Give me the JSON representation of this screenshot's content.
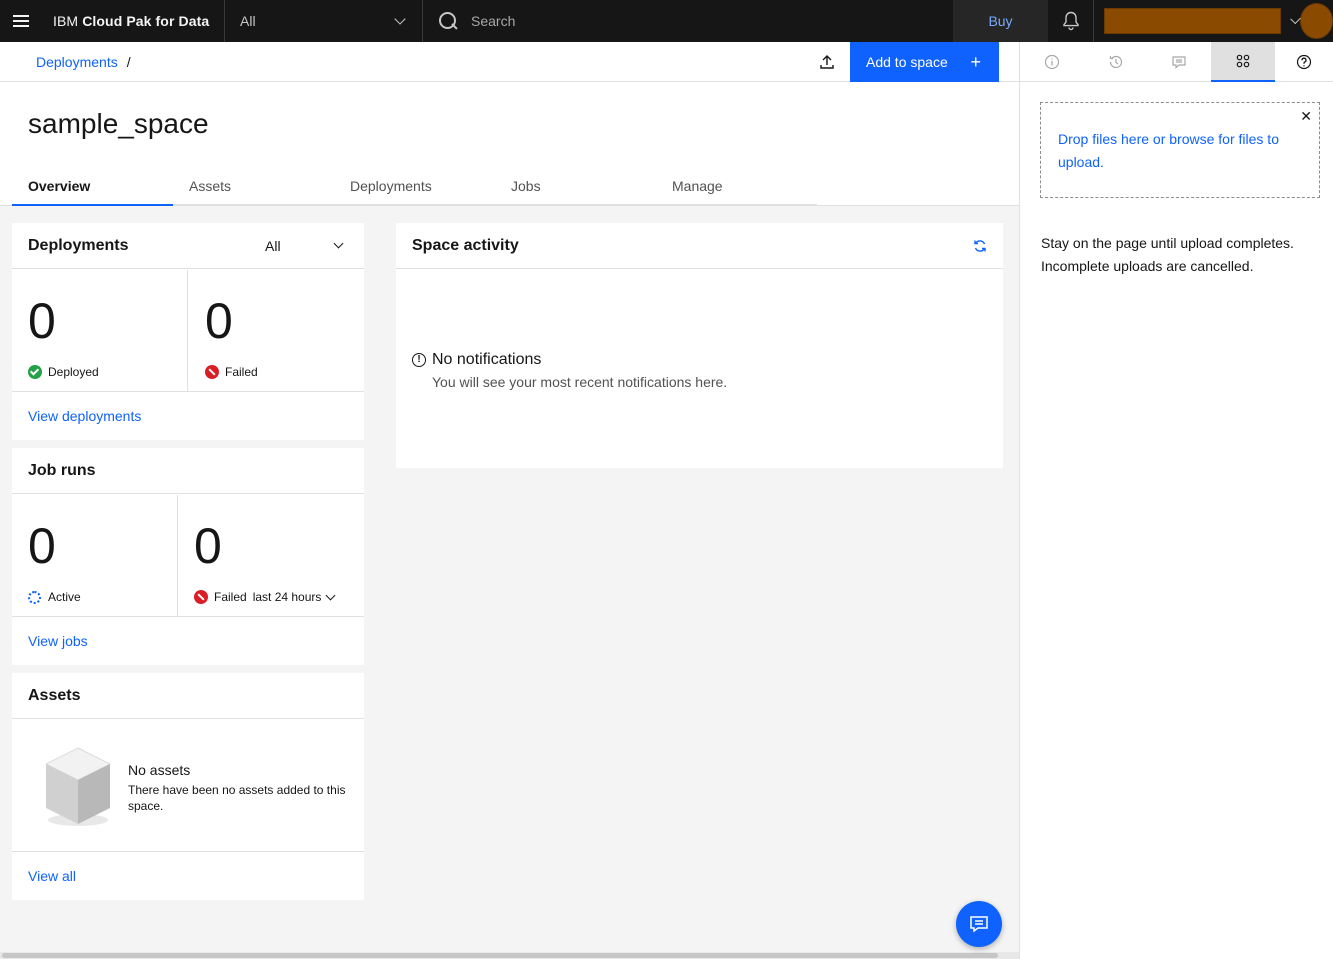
{
  "header": {
    "brand_prefix": "IBM",
    "brand_name": "Cloud Pak for Data",
    "scope_value": "All",
    "search_placeholder": "Search",
    "buy_label": "Buy"
  },
  "breadcrumb": {
    "root": "Deployments",
    "separator": "/"
  },
  "toolbar": {
    "add_to_space_label": "Add to space"
  },
  "page": {
    "title": "sample_space",
    "tabs": [
      {
        "label": "Overview",
        "active": true
      },
      {
        "label": "Assets",
        "active": false
      },
      {
        "label": "Deployments",
        "active": false
      },
      {
        "label": "Jobs",
        "active": false
      },
      {
        "label": "Manage",
        "active": false
      }
    ]
  },
  "deployments_card": {
    "title": "Deployments",
    "filter_value": "All",
    "deployed_count": "0",
    "deployed_label": "Deployed",
    "failed_count": "0",
    "failed_label": "Failed",
    "link": "View deployments"
  },
  "jobs_card": {
    "title": "Job runs",
    "active_count": "0",
    "active_label": "Active",
    "failed_count": "0",
    "failed_label": "Failed",
    "period": "last 24 hours",
    "link": "View jobs"
  },
  "assets_card": {
    "title": "Assets",
    "empty_title": "No assets",
    "empty_text": "There have been no assets added to this space.",
    "link": "View all"
  },
  "activity_card": {
    "title": "Space activity",
    "empty_title": "No notifications",
    "empty_text": "You will see your most recent notifications here."
  },
  "right_panel": {
    "drop_text": "Drop files here or browse for files to upload.",
    "note": "Stay on the page until upload completes. Incomplete uploads are cancelled.",
    "close_glyph": "✕"
  },
  "colors": {
    "primary": "#0f62fe",
    "header_bg": "#161616",
    "success": "#24a148",
    "error": "#da1e28",
    "account_redacted": "#8a4a00"
  }
}
